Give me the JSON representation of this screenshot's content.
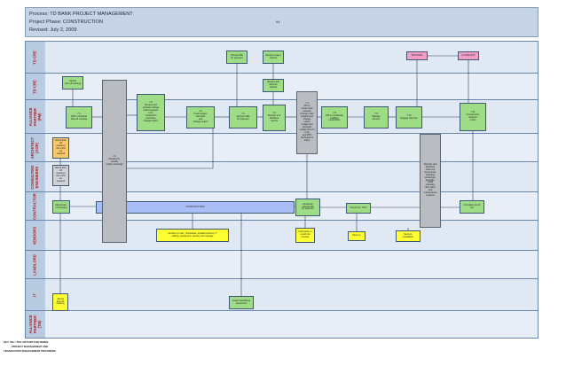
{
  "header": {
    "process": "Process: TD BANK PROJECT MANAGEMENT",
    "phase": "Project Phase: CONSTRUCTION",
    "revised": "Revised: July 2, 2009",
    "page": "94"
  },
  "lanes": [
    {
      "label": "TD CRE",
      "key": "crd"
    },
    {
      "label": "TD CRE",
      "key": "cre"
    },
    {
      "label": "ALLIANCE\nPARTNER\n(PM)",
      "key": "pm"
    },
    {
      "label": "ARCHITECT\n(AOR)",
      "key": "aor"
    },
    {
      "label": "CONSULTING\nENGINEERS",
      "key": "eng"
    },
    {
      "label": "CONTRACTOR",
      "key": "gc"
    },
    {
      "label": "VENDORS",
      "key": "vendors"
    },
    {
      "label": "LANDLORD",
      "key": "landlord"
    },
    {
      "label": "IT",
      "key": "it"
    },
    {
      "label": "ALLIANCE\nPARTNER\n(TM)",
      "key": "tm"
    }
  ],
  "boxes": {
    "process_app_payments": "Process Bill\nfor payment",
    "review_cre": "Review project\nreports",
    "invoices": "INVOICES",
    "close_out": "CLOSE OUT",
    "attend_kickoff": "Attend\nkick-off meeting",
    "review_approve": "Review and\napprove\nreports",
    "pm_kickoff": "7.1\nPM to schedule\nkick-off meeting",
    "review_issue": "7.3\nReview and\nprocess change\norder requests\nfrom\ncontractors\nand issue\nchange orders",
    "track_budget": "7.4\nTrack budget,\nschedule\nand\nchange orders",
    "approve_bill": "7.5\nApprove bills\nfor payment",
    "prepare_reports": "7.6\nPrepare and\ndistribute\nreports",
    "change_order": "7.7\nIf change in\nscope, issue\nchange order",
    "review_work": "7.8\nPM to coordinate\nbuilding\ninspections",
    "manage_fixtures": "7.9\nManage\nfixtures",
    "engage_security": "7.10\nEngage Security",
    "construction_closeout": "7.11\nConstruction\ncloseout\nreport",
    "attend_aor": "Attend kick-off\nmeeting /\nsite visits\nas\nrequired",
    "attend_eng": "Attend kick-off\nmeeting /\nsite visits\nas\nrequired",
    "gc_kickoff": "Attend kick-\noff meeting",
    "construction": "CONSTRUCTION",
    "contractor_sub": "Contractor\nsubmits bill\nfor payment",
    "punch_list": "Punch list / TCO",
    "complete_punch": "Complete punch\nlist",
    "vendors_coordinate": "Vendors on site - Schedules, installs furniture, IT\ncabling, equipment, security and signage",
    "participate": "Participate in\npunch list\nprocess",
    "move": "Move-in",
    "security": "Security\ninstallation",
    "it_attend": "Attend\nkick-off\nmeeting",
    "it_install": "Install Voice/Data\nequipment"
  },
  "bars": {
    "site_meetings": "7.2\nConduct bi-\nweekly\nproject meetings",
    "pm_change": "7.4\nPM to\nreview and\nprocess\nchange order\nrequest and\nchange\norders\nbudget and\nschedule\nupdate (Punch List)\nand PPS\n(Schedule & Plan)",
    "closeout_bar": "Develop and\ndistribute\nclose-out\ndocuments\nincluding\nwarranties,\nas-builts,\nO&M\nmanuals,\nattic stock\nand\nmaintenance\ncontacts"
  },
  "footer": {
    "line1": "KEY: PM = TDG OR PARTS BETWEEN",
    "line2": "PROJECT MANAGEMENT AND",
    "line3": "TRANSACTION MANAGEMENT PROVIDERS"
  }
}
